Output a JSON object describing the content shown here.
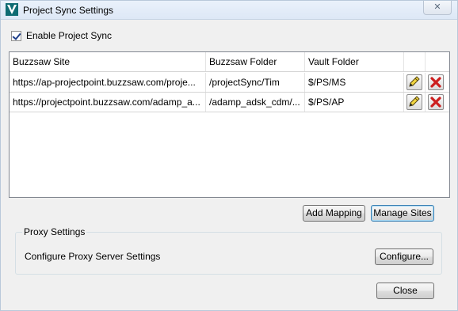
{
  "window": {
    "title": "Project Sync Settings",
    "close_glyph": "✕"
  },
  "enable_sync": {
    "label": "Enable Project Sync",
    "checked": true
  },
  "grid": {
    "columns": [
      "Buzzsaw Site",
      "Buzzsaw Folder",
      "Vault Folder"
    ],
    "rows": [
      {
        "site": "https://ap-projectpoint.buzzsaw.com/proje...",
        "folder": "/projectSync/Tim",
        "vault": "$/PS/MS"
      },
      {
        "site": "https://projectpoint.buzzsaw.com/adamp_a...",
        "folder": "/adamp_adsk_cdm/...",
        "vault": "$/PS/AP"
      }
    ],
    "row_actions": [
      "pencil-icon",
      "delete-x-icon"
    ]
  },
  "buttons": {
    "add_mapping": "Add Mapping",
    "manage_sites": "Manage Sites",
    "configure": "Configure...",
    "close": "Close"
  },
  "proxy": {
    "group_title": "Proxy Settings",
    "label": "Configure Proxy Server Settings"
  },
  "colors": {
    "delete_red": "#cc1f1f",
    "pencil_yellow": "#f2d640",
    "app_logo_teal": "#0e6b72"
  }
}
